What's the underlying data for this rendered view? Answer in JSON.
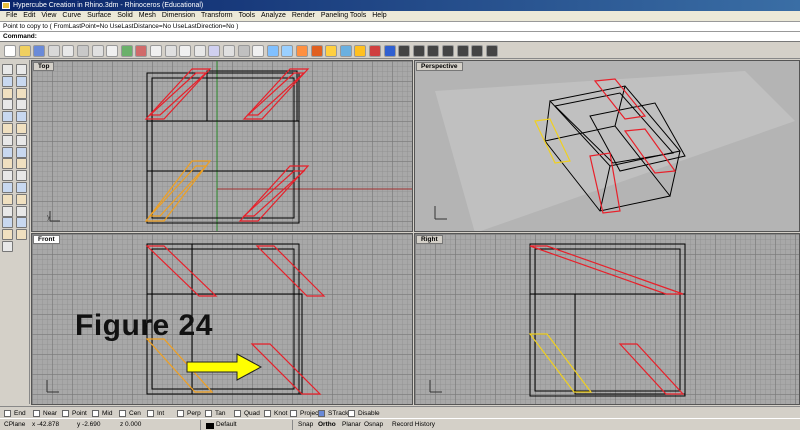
{
  "window": {
    "title": "Hypercube Creation in Rhino.3dm - Rhinoceros (Educational)"
  },
  "menu": [
    "File",
    "Edit",
    "View",
    "Curve",
    "Surface",
    "Solid",
    "Mesh",
    "Dimension",
    "Transform",
    "Tools",
    "Analyze",
    "Render",
    "Paneling Tools",
    "Help"
  ],
  "command": {
    "history": "Point to copy to ( FromLastPoint=No  UseLastDistance=No  UseLastDirection=No )",
    "prompt_label": "Command:",
    "value": ""
  },
  "viewports": {
    "top": {
      "label": "Top"
    },
    "perspective": {
      "label": "Perspective"
    },
    "front": {
      "label": "Front"
    },
    "right": {
      "label": "Right"
    }
  },
  "annotation": {
    "figure_label": "Figure 24"
  },
  "osnap": [
    "End",
    "Near",
    "Point",
    "Mid",
    "Cen",
    "Int",
    "Perp",
    "Tan",
    "Quad",
    "Knot",
    "Project",
    "STrack",
    "Disable"
  ],
  "status": {
    "cplane": "CPlane",
    "x": "x -42.878",
    "y": "y -2.690",
    "z": "z 0.000",
    "layer": "Default",
    "snap": "Snap",
    "ortho": "Ortho",
    "planar": "Planar",
    "osnap": "Osnap",
    "history": "Record History"
  },
  "colors": {
    "selected_red": "#e8202a",
    "highlight_yellow": "#f0e020",
    "wire": "#000000",
    "arrow": "#ffff00"
  }
}
